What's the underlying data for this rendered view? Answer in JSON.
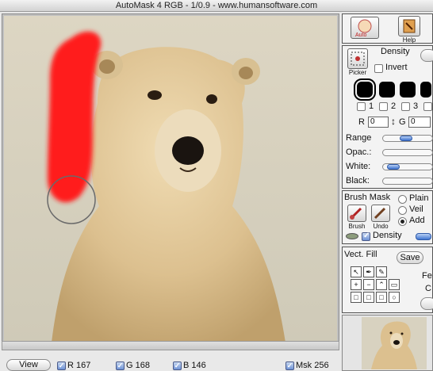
{
  "window": {
    "title": "AutoMask 4 RGB - 1/0.9 - www.humansoftware.com"
  },
  "top_panel": {
    "help_label": "Help"
  },
  "density_panel": {
    "title": "Density",
    "picker_label": "Picker",
    "invert_label": "Invert",
    "layer_checks": [
      "1",
      "2",
      "3"
    ],
    "r_label": "R",
    "r_value": "0",
    "g_label": "G",
    "g_value": "0",
    "sliders": [
      {
        "label": "Range",
        "level": 0.45
      },
      {
        "label": "Opac.:",
        "level": 0.0
      },
      {
        "label": "White:",
        "level": 0.1
      },
      {
        "label": "Black:",
        "level": 0.0
      }
    ]
  },
  "brush_panel": {
    "title": "Brush Mask",
    "brush_label": "Brush",
    "undo_label": "Undo",
    "modes": [
      "Plain",
      "Veil",
      "Add"
    ],
    "selected_mode": "Add",
    "density_label": "Density"
  },
  "vect_panel": {
    "title": "Vect. Fill",
    "save_label": "Save",
    "fe_label": "Fe",
    "c_label": "C"
  },
  "status": {
    "view_label": "View",
    "r": "R 167",
    "g": "G 168",
    "b": "B 146",
    "msk": "Msk 256"
  },
  "colors": {
    "mask_red": "#ff1a1a",
    "accent_blue": "#3f74d0"
  }
}
